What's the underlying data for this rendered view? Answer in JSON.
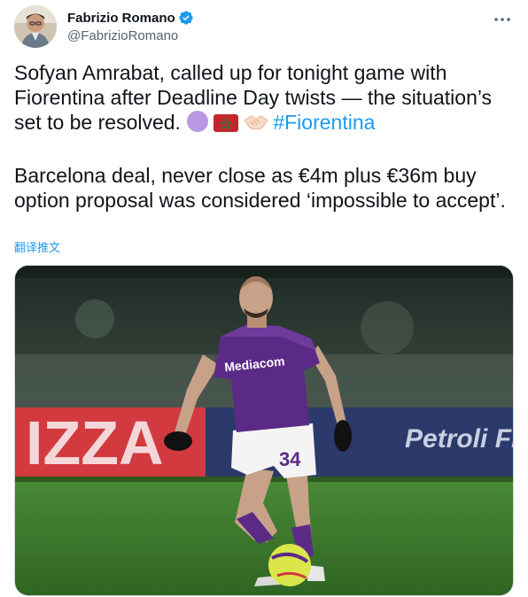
{
  "author": {
    "display_name": "Fabrizio Romano",
    "handle": "@FabrizioRomano",
    "verified_icon": "verified-badge-icon",
    "avatar_icon": "avatar-photo"
  },
  "menu": {
    "icon": "more-horizontal-icon"
  },
  "tweet": {
    "paragraph1_text": "Sofyan Amrabat, called up for tonight game with Fiorentina after Deadline Day twists — the situation’s set to be resolved.",
    "emojis": [
      "purple-circle-emoji",
      "morocco-flag-emoji",
      "handshake-emoji"
    ],
    "hashtag": "#Fiorentina",
    "paragraph2_text": "Barcelona deal, never close as €4m plus €36m buy option proposal was considered ‘impossible to accept’."
  },
  "translate_link": "翻译推文",
  "media": {
    "shirt_sponsor": "Mediacom",
    "shirt_number": "34",
    "board_left_text": "IZZA",
    "board_right_text": "Petroli Firenze",
    "colors": {
      "kit_purple": "#5b2a86",
      "pitch_green": "#3f7a2e",
      "board_red": "#d23a3f",
      "board_blue": "#2b3a6b"
    }
  }
}
